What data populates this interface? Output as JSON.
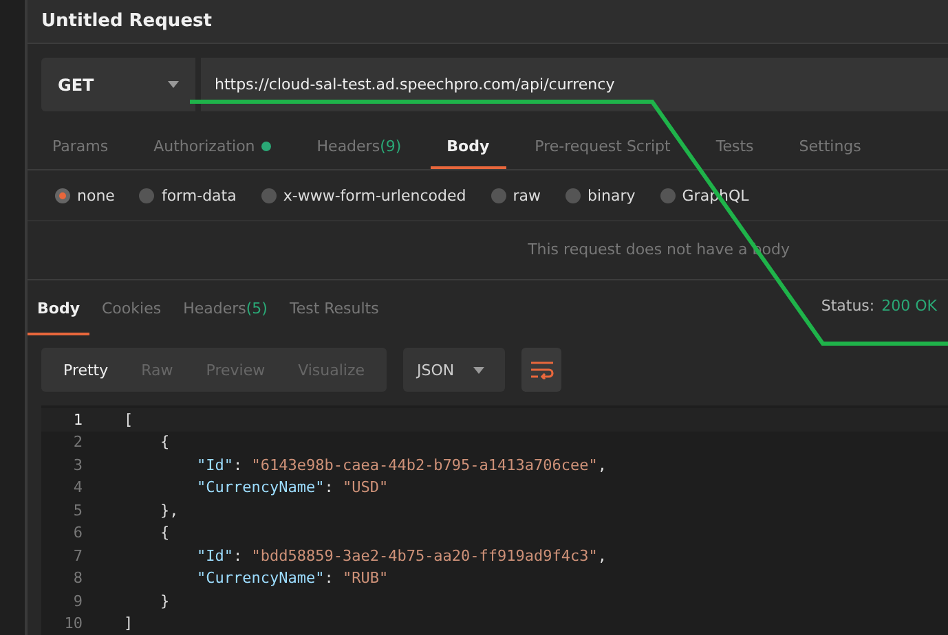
{
  "title": "Untitled Request",
  "request": {
    "method": "GET",
    "url": "https://cloud-sal-test.ad.speechpro.com/api/currency"
  },
  "request_tabs": [
    {
      "label": "Params",
      "selected": false
    },
    {
      "label": "Authorization",
      "selected": false,
      "dot": true
    },
    {
      "label": "Headers",
      "count": "(9)",
      "selected": false
    },
    {
      "label": "Body",
      "selected": true
    },
    {
      "label": "Pre-request Script",
      "selected": false
    },
    {
      "label": "Tests",
      "selected": false
    },
    {
      "label": "Settings",
      "selected": false
    }
  ],
  "body_types": [
    {
      "label": "none",
      "selected": true
    },
    {
      "label": "form-data",
      "selected": false
    },
    {
      "label": "x-www-form-urlencoded",
      "selected": false
    },
    {
      "label": "raw",
      "selected": false
    },
    {
      "label": "binary",
      "selected": false
    },
    {
      "label": "GraphQL",
      "selected": false
    }
  ],
  "body_message": "This request does not have a body",
  "response_tabs": [
    {
      "label": "Body",
      "selected": true
    },
    {
      "label": "Cookies",
      "selected": false
    },
    {
      "label": "Headers",
      "count": "(5)",
      "selected": false
    },
    {
      "label": "Test Results",
      "selected": false
    }
  ],
  "status": {
    "label": "Status:",
    "value": "200 OK"
  },
  "view_modes": [
    {
      "label": "Pretty",
      "selected": true
    },
    {
      "label": "Raw",
      "selected": false
    },
    {
      "label": "Preview",
      "selected": false
    },
    {
      "label": "Visualize",
      "selected": false
    }
  ],
  "format": "JSON",
  "code_lines": [
    {
      "number": "1",
      "current": true,
      "tokens": [
        {
          "kind": "punct",
          "text": "["
        }
      ]
    },
    {
      "number": "2",
      "current": false,
      "tokens": [
        {
          "kind": "punct",
          "text": "    {"
        }
      ]
    },
    {
      "number": "3",
      "current": false,
      "tokens": [
        {
          "kind": "key",
          "text": "        \"Id\""
        },
        {
          "kind": "punct",
          "text": ": "
        },
        {
          "kind": "string",
          "text": "\"6143e98b-caea-44b2-b795-a1413a706cee\""
        },
        {
          "kind": "punct",
          "text": ","
        }
      ]
    },
    {
      "number": "4",
      "current": false,
      "tokens": [
        {
          "kind": "key",
          "text": "        \"CurrencyName\""
        },
        {
          "kind": "punct",
          "text": ": "
        },
        {
          "kind": "string",
          "text": "\"USD\""
        }
      ]
    },
    {
      "number": "5",
      "current": false,
      "tokens": [
        {
          "kind": "punct",
          "text": "    },"
        }
      ]
    },
    {
      "number": "6",
      "current": false,
      "tokens": [
        {
          "kind": "punct",
          "text": "    {"
        }
      ]
    },
    {
      "number": "7",
      "current": false,
      "tokens": [
        {
          "kind": "key",
          "text": "        \"Id\""
        },
        {
          "kind": "punct",
          "text": ": "
        },
        {
          "kind": "string",
          "text": "\"bdd58859-3ae2-4b75-aa20-ff919ad9f4c3\""
        },
        {
          "kind": "punct",
          "text": ","
        }
      ]
    },
    {
      "number": "8",
      "current": false,
      "tokens": [
        {
          "kind": "key",
          "text": "        \"CurrencyName\""
        },
        {
          "kind": "punct",
          "text": ": "
        },
        {
          "kind": "string",
          "text": "\"RUB\""
        }
      ]
    },
    {
      "number": "9",
      "current": false,
      "tokens": [
        {
          "kind": "punct",
          "text": "    }"
        }
      ]
    },
    {
      "number": "10",
      "current": false,
      "tokens": [
        {
          "kind": "punct",
          "text": "]"
        }
      ]
    }
  ]
}
